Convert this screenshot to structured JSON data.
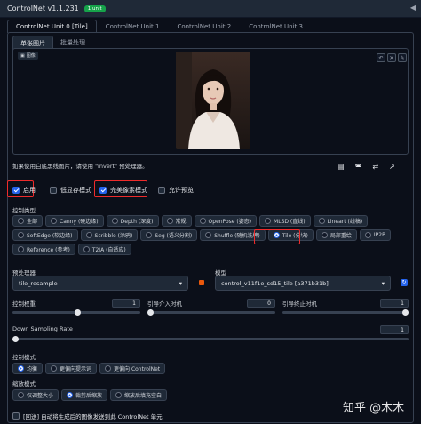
{
  "header": {
    "title": "ControlNet v1.1.231",
    "badge": "1 unit",
    "collapse": "◀"
  },
  "unit_tabs": [
    "ControlNet Unit 0 [Tile]",
    "ControlNet Unit 1",
    "ControlNet Unit 2",
    "ControlNet Unit 3"
  ],
  "sub_tabs": [
    "单张图片",
    "批量处理"
  ],
  "image_panel": {
    "label": "图像",
    "tools": [
      "↶",
      "✕",
      "✎"
    ]
  },
  "hint": "如果使用白底黑线图片，请使用 \"invert\" 预处理器。",
  "hint_icons": [
    "▤",
    "◚",
    "⇄",
    "↗"
  ],
  "checkboxes": [
    {
      "label": "启用",
      "checked": true
    },
    {
      "label": "低显存模式",
      "checked": false
    },
    {
      "label": "完美像素模式",
      "checked": true
    },
    {
      "label": "允许预览",
      "checked": false
    }
  ],
  "control_type": {
    "label": "控制类型",
    "rows": [
      [
        {
          "label": "全部",
          "on": false
        },
        {
          "label": "Canny (硬边缘)",
          "on": false
        },
        {
          "label": "Depth (深度)",
          "on": false
        },
        {
          "label": "常规",
          "on": false
        },
        {
          "label": "OpenPose (姿态)",
          "on": false
        },
        {
          "label": "MLSD (直线)",
          "on": false
        },
        {
          "label": "Lineart (线稿)",
          "on": false
        }
      ],
      [
        {
          "label": "SoftEdge (软边缘)",
          "on": false
        },
        {
          "label": "Scribble (涂鸦)",
          "on": false
        },
        {
          "label": "Seg (语义分割)",
          "on": false
        },
        {
          "label": "Shuffle (随机洗牌)",
          "on": false
        },
        {
          "label": "Tile (分块)",
          "on": true
        },
        {
          "label": "局部重绘",
          "on": false
        },
        {
          "label": "IP2P",
          "on": false
        }
      ],
      [
        {
          "label": "Reference (参考)",
          "on": false
        },
        {
          "label": "T2IA (自适应)",
          "on": false
        }
      ]
    ]
  },
  "preprocessor": {
    "label": "预处理器",
    "value": "tile_resample"
  },
  "model": {
    "label": "模型",
    "value": "control_v11f1e_sd15_tile [a371b31b]"
  },
  "sliders": {
    "weight": {
      "label": "控制权重",
      "value": "1",
      "fraction": 0.5
    },
    "start": {
      "label": "引导介入时机",
      "value": "0",
      "fraction": 0.0
    },
    "end": {
      "label": "引导终止时机",
      "value": "1",
      "fraction": 1.0
    },
    "down": {
      "label": "Down Sampling Rate",
      "value": "1",
      "fraction": 0.0
    }
  },
  "control_mode": {
    "label": "控制模式",
    "options": [
      {
        "label": "均衡",
        "on": true
      },
      {
        "label": "更偏向提示词",
        "on": false
      },
      {
        "label": "更偏向 ControlNet",
        "on": false
      }
    ]
  },
  "resize_mode": {
    "label": "缩放模式",
    "options": [
      {
        "label": "仅调整大小",
        "on": false
      },
      {
        "label": "裁剪后缩放",
        "on": true
      },
      {
        "label": "缩放后填充空白",
        "on": false
      }
    ]
  },
  "loopback": {
    "label": "[回送] 自动将生成后的图像发送到此 ControlNet 单元",
    "checked": false
  },
  "watermark": "知乎 @木木",
  "colors": {
    "accent": "#2563eb",
    "highlight": "#ef2b2b",
    "badge": "#16a34a"
  }
}
